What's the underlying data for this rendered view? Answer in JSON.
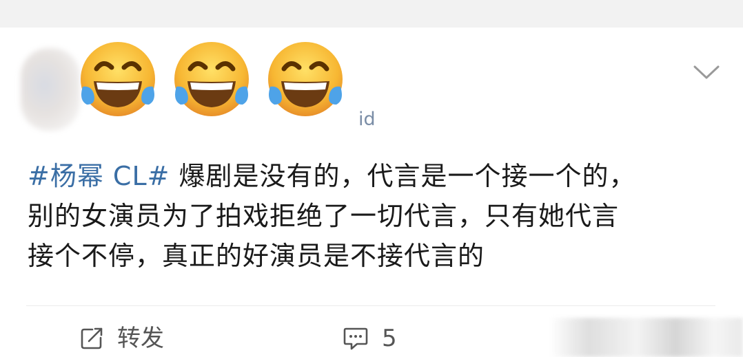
{
  "post": {
    "emoji_icons": [
      "tears-of-joy-emoji",
      "tears-of-joy-emoji",
      "tears-of-joy-emoji"
    ],
    "suffix": "id",
    "hashtag": "#杨幂 CL#",
    "body_line1": " 爆剧是没有的，代言是一个接一个的，",
    "body_line2": "别的女演员为了拍戏拒绝了一切代言，只有她代言",
    "body_line3": "接个不停，真正的好演员是不接代言的"
  },
  "actions": {
    "repost_label": "转发",
    "comment_count": "5"
  },
  "colors": {
    "hashtag": "#3a6ea5",
    "text": "#1a1a1a",
    "action": "#555555"
  }
}
